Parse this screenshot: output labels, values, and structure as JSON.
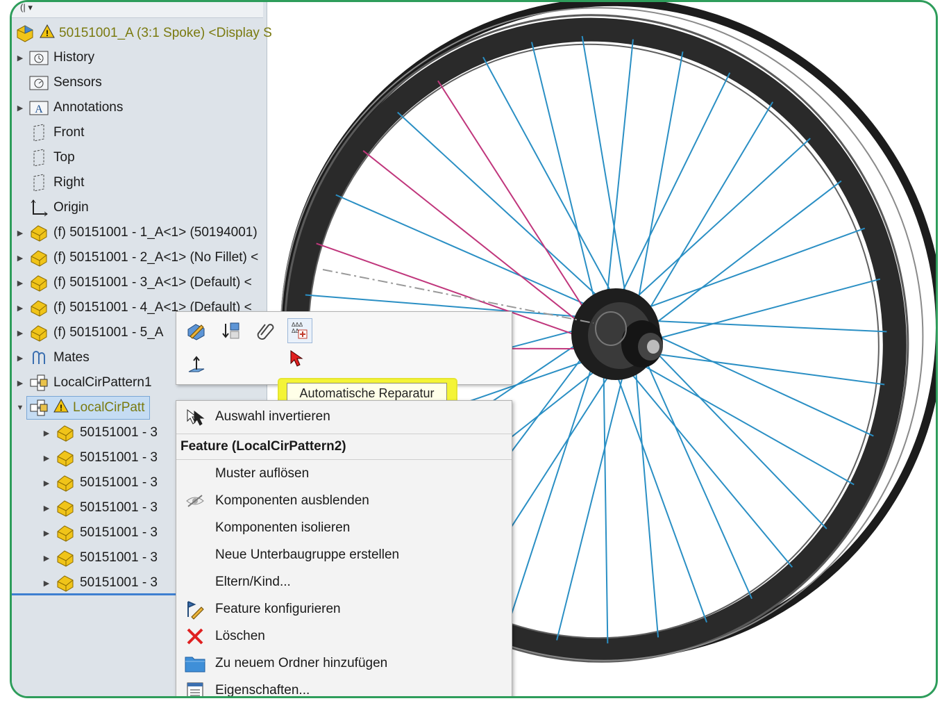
{
  "tree": {
    "top_label": "(| ▾",
    "root_label": "50151001_A (3:1 Spoke) <Display S",
    "items": [
      {
        "label": "History"
      },
      {
        "label": "Sensors"
      },
      {
        "label": "Annotations"
      },
      {
        "label": "Front"
      },
      {
        "label": "Top"
      },
      {
        "label": "Right"
      },
      {
        "label": "Origin"
      },
      {
        "label": "(f) 50151001 - 1_A<1> (50194001)"
      },
      {
        "label": "(f) 50151001 - 2_A<1> (No Fillet) <"
      },
      {
        "label": "(f) 50151001 - 3_A<1> (Default) <"
      },
      {
        "label": "(f) 50151001 - 4_A<1> (Default) <"
      },
      {
        "label": "(f) 50151001 - 5_A"
      },
      {
        "label": "Mates"
      },
      {
        "label": "LocalCirPattern1"
      },
      {
        "label": "LocalCirPatt"
      }
    ],
    "children": [
      "50151001 - 3",
      "50151001 - 3",
      "50151001 - 3",
      "50151001 - 3",
      "50151001 - 3",
      "50151001 - 3",
      "50151001 - 3"
    ]
  },
  "tooltip": {
    "text": "Automatische Reparatur"
  },
  "menu": {
    "invert": "Auswahl invertieren",
    "header": "Feature (LocalCirPattern2)",
    "items": [
      {
        "label": "Muster auflösen"
      },
      {
        "label": "Komponenten ausblenden"
      },
      {
        "label": "Komponenten isolieren"
      },
      {
        "label": "Neue Unterbaugruppe erstellen"
      },
      {
        "label": "Eltern/Kind..."
      },
      {
        "label": "Feature konfigurieren"
      },
      {
        "label": "Löschen"
      },
      {
        "label": "Zu neuem Ordner hinzufügen"
      },
      {
        "label": "Eigenschaften..."
      }
    ]
  },
  "colors": {
    "accent": "#2e9d5b",
    "selection": "#c5dcf3",
    "tooltip": "#f4f436",
    "spoke_blue": "#2a8fc4",
    "spoke_pink": "#c0367c",
    "warning": "#f1c40f",
    "part_yellow": "#f0c419"
  }
}
